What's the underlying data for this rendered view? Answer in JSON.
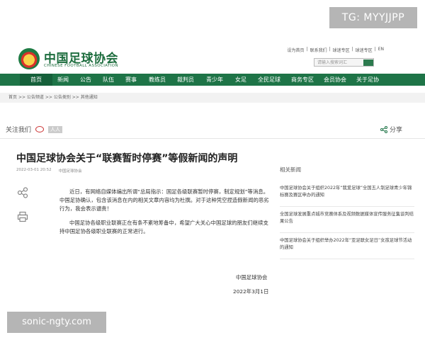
{
  "watermarks": {
    "tg": "TG: MYYJJPP",
    "site": "sonic-ngty.com"
  },
  "header": {
    "logo_cn": "中国足球协会",
    "logo_en": "CHINESE FOOTBALL ASSOCIATION",
    "top_links": [
      "设为首页",
      "|",
      "联系我们",
      "|",
      "球迷专区",
      "|",
      "球迷专区",
      "|",
      "EN"
    ],
    "search_placeholder": "请输入搜索词汇"
  },
  "nav": {
    "items": [
      "首页",
      "新闻",
      "公告",
      "队伍",
      "赛事",
      "教练员",
      "裁判员",
      "青少年",
      "女足",
      "全民足球",
      "商务专区",
      "会员协会",
      "关于足协"
    ]
  },
  "breadcrumb": {
    "items": [
      "首页",
      ">>",
      "公告频道",
      ">>",
      "公告类别",
      ">>",
      "其他通知"
    ]
  },
  "share": {
    "follow_label": "关注我们",
    "renren": "人人",
    "share_label": "分享"
  },
  "article": {
    "title": "中国足球协会关于“联赛暂时停赛”等假新闻的声明",
    "date_meta": "2022-03-01 20:52",
    "source_meta": "中国足球协会",
    "paragraphs": [
      "近日，有网络自媒体编出所谓“总局指示：国足各级联赛暂时停赛，制定规划”等消息。中国足协确认，包含该消息在内的相关文章内容均为杜撰。对于这种凭空捏造假新闻的恶劣行为，我会表示谴责！",
      "中国足协各级职业联赛正在有条不紊地筹备中，希望广大关心中国足球的朋友们继续支持中国足协各级职业联赛的正常进行。"
    ],
    "signature": "中国足球协会",
    "date": "2022年3月1日"
  },
  "related": {
    "heading": "相关新闻",
    "items": [
      "中国足球协会关于组织2022年“我爱足球”全国五人制足球青少年锦标赛及赛区申办的通知",
      "全国足球发展重点城市竞赛体系及视频数据媒体宣传服务征集谈判结果公告",
      "中国足球协会关于组织举办2022年“亚足联女足日”女孩足球节活动的通知"
    ]
  },
  "colors": {
    "nav_green": "#1e7447",
    "brand_green": "#1d6d3e"
  }
}
